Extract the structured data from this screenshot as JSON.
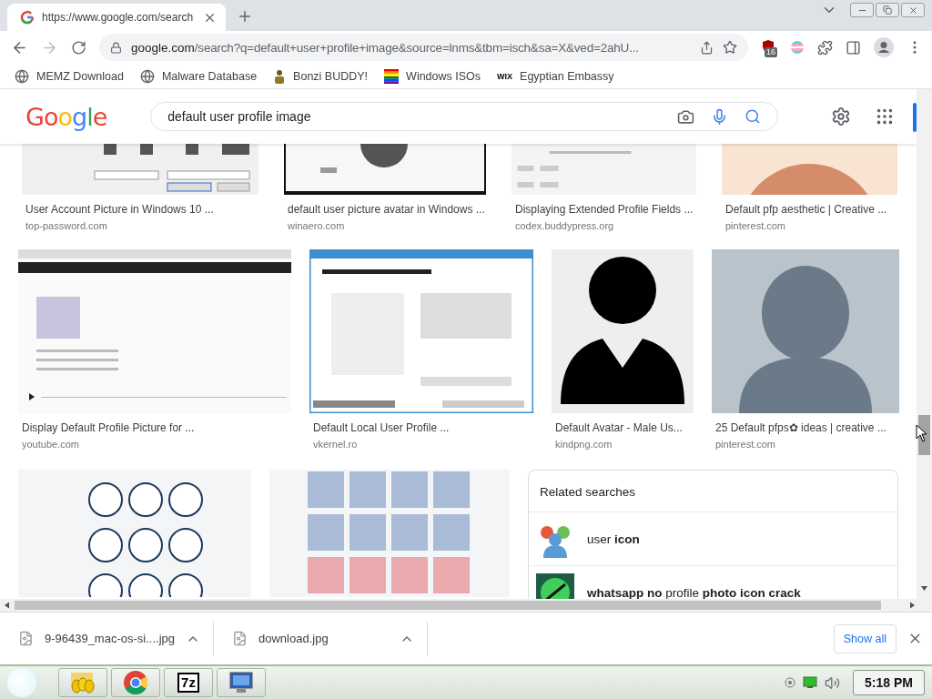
{
  "tabs": [
    {
      "title": "https://www.google.com/search",
      "selected": true
    }
  ],
  "toolbar": {
    "forward": {
      "disabled": true
    },
    "host": "google.com",
    "path": "/search?q=default+user+profile+image&source=lnms&tbm=isch&sa=X&ved=2ahU...",
    "extension_badge": "16"
  },
  "bookmarks": [
    {
      "label": "MEMZ Download",
      "kind": "globe"
    },
    {
      "label": "Malware Database",
      "kind": "globe"
    },
    {
      "label": "Bonzi BUDDY!",
      "kind": "figure"
    },
    {
      "label": "Windows ISOs",
      "kind": "rainbow"
    },
    {
      "label": "Egyptian Embassy",
      "kind": "mark",
      "mark": "WIX"
    }
  ],
  "search": {
    "logo": "Google",
    "query": "default user profile image"
  },
  "result_rows": [
    {
      "items": [
        {
          "title": "User Account Picture in Windows 10 ...",
          "source": "top-password.com"
        },
        {
          "title": "default user picture avatar in Windows ...",
          "source": "winaero.com"
        },
        {
          "title": "Displaying Extended Profile Fields ...",
          "source": "codex.buddypress.org"
        },
        {
          "title": "Default pfp aesthetic | Creative ...",
          "source": "pinterest.com"
        }
      ]
    },
    {
      "items": [
        {
          "title": "Display Default Profile Picture for ...",
          "source": "youtube.com"
        },
        {
          "title": "Default Local User Profile ...",
          "source": "vkernel.ro"
        },
        {
          "title": "Default Avatar - Male Us...",
          "source": "kindpng.com"
        },
        {
          "title": "25 Default pfps✿ ideas | creative ...",
          "source": "pinterest.com"
        }
      ]
    },
    {
      "items": [
        {
          "kind": "picture"
        },
        {
          "kind": "picture"
        }
      ]
    }
  ],
  "related": {
    "title": "Related searches",
    "items": [
      "user **icon**",
      "**whatsapp no** profile **photo icon crack**"
    ]
  },
  "downloads": {
    "items": [
      "9-96439_mac-os-si....jpg",
      "download.jpg"
    ],
    "show_all": "Show all"
  },
  "taskbar": {
    "apps": [
      {
        "kind": "folder"
      },
      {
        "kind": "chrome"
      },
      {
        "kind": "archiver",
        "label": "7z"
      },
      {
        "kind": "monitor"
      }
    ],
    "clock": "5:18 PM"
  }
}
